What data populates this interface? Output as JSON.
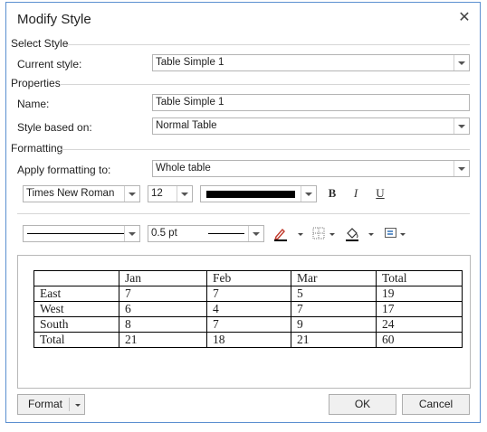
{
  "window": {
    "title": "Modify Style"
  },
  "sections": {
    "select_style": "Select Style",
    "properties": "Properties",
    "formatting": "Formatting"
  },
  "select_style": {
    "current_style_label": "Current style:",
    "current_style_value": "Table Simple 1"
  },
  "properties": {
    "name_label": "Name:",
    "name_value": "Table Simple 1",
    "based_on_label": "Style based on:",
    "based_on_value": "Normal Table"
  },
  "formatting": {
    "apply_label": "Apply formatting to:",
    "apply_value": "Whole table",
    "font_name": "Times New Roman",
    "font_size": "12",
    "font_color": "#000000",
    "bold": "B",
    "italic": "I",
    "underline": "U",
    "border_width": "0.5 pt",
    "icons": [
      "pen-color-icon",
      "borders-icon",
      "shading-icon",
      "alignment-icon"
    ]
  },
  "preview": {
    "rows": [
      [
        "",
        "Jan",
        "Feb",
        "Mar",
        "Total"
      ],
      [
        "East",
        "7",
        "7",
        "5",
        "19"
      ],
      [
        "West",
        "6",
        "4",
        "7",
        "17"
      ],
      [
        "South",
        "8",
        "7",
        "9",
        "24"
      ],
      [
        "Total",
        "21",
        "18",
        "21",
        "60"
      ]
    ]
  },
  "buttons": {
    "format": "Format",
    "ok": "OK",
    "cancel": "Cancel"
  }
}
